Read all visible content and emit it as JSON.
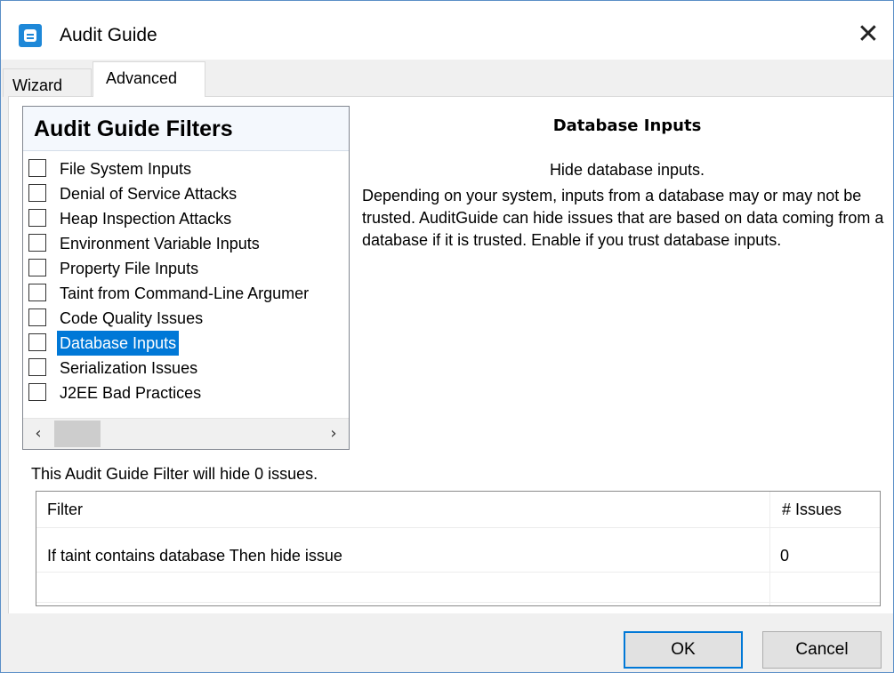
{
  "window": {
    "title": "Audit Guide",
    "icon": "audit-guide-app-icon",
    "close_glyph": "✕"
  },
  "tabs": [
    {
      "label": "Wizard",
      "active": false
    },
    {
      "label": "Advanced",
      "active": true
    }
  ],
  "filters": {
    "header": "Audit Guide Filters",
    "items": [
      {
        "label": "File System Inputs",
        "checked": false,
        "selected": false
      },
      {
        "label": "Denial of Service Attacks",
        "checked": false,
        "selected": false
      },
      {
        "label": "Heap Inspection Attacks",
        "checked": false,
        "selected": false
      },
      {
        "label": "Environment Variable Inputs",
        "checked": false,
        "selected": false
      },
      {
        "label": "Property File Inputs",
        "checked": false,
        "selected": false
      },
      {
        "label": "Taint from Command-Line Argumer",
        "checked": false,
        "selected": false
      },
      {
        "label": "Code Quality Issues",
        "checked": false,
        "selected": false
      },
      {
        "label": "Database Inputs",
        "checked": false,
        "selected": true
      },
      {
        "label": "Serialization Issues",
        "checked": false,
        "selected": false
      },
      {
        "label": "J2EE Bad Practices",
        "checked": false,
        "selected": false
      }
    ],
    "scroll_left_glyph": "‹",
    "scroll_right_glyph": "›"
  },
  "description": {
    "title": "Database Inputs",
    "subtitle": "Hide database inputs.",
    "body": "Depending on your system, inputs from a database may or may not be trusted. AuditGuide can hide issues that are based on data coming from a database if it is trusted. Enable if you trust database inputs."
  },
  "summary": "This Audit Guide Filter will hide 0 issues.",
  "table": {
    "columns": [
      "Filter",
      "# Issues"
    ],
    "rows": [
      {
        "filter": "If taint contains database Then hide issue",
        "issues": "0"
      }
    ]
  },
  "buttons": {
    "ok": "OK",
    "cancel": "Cancel"
  },
  "colors": {
    "selection": "#0078d7",
    "window_border": "#5b8fc7",
    "app_icon": "#1e88d8"
  }
}
